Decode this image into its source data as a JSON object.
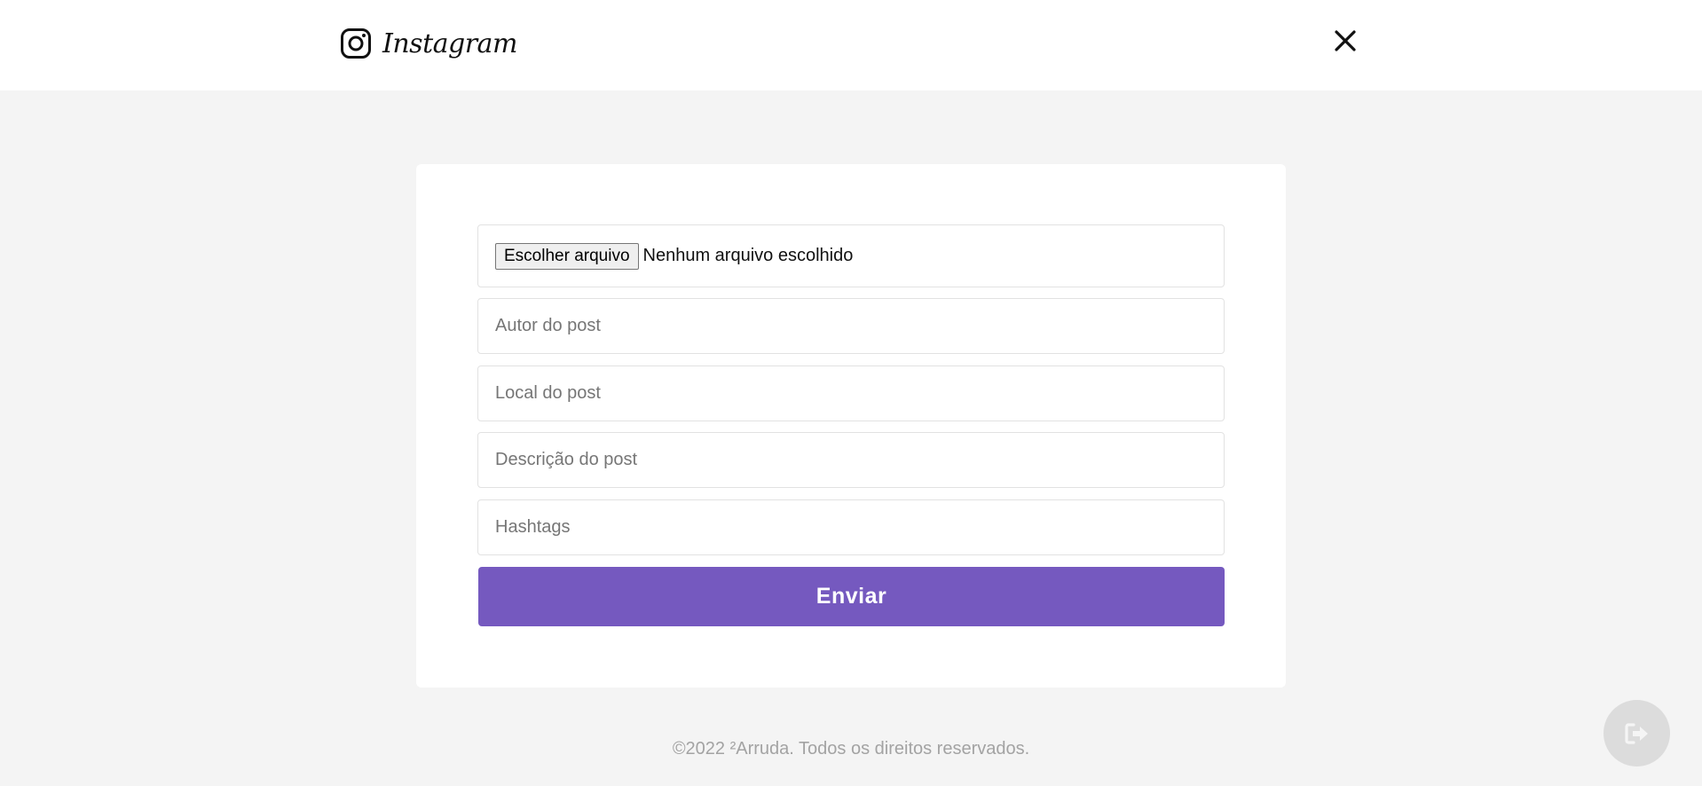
{
  "header": {
    "logo_text": "Instagram",
    "logo_icon": "instagram-icon",
    "close_icon": "close-icon"
  },
  "form": {
    "file_button_label": "Escolher arquivo",
    "file_status": "Nenhum arquivo escolhido",
    "author_placeholder": "Autor do post",
    "location_placeholder": "Local do post",
    "description_placeholder": "Descrição do post",
    "hashtags_placeholder": "Hashtags",
    "submit_label": "Enviar"
  },
  "footer": {
    "copyright": "©2022 ²Arruda. Todos os direitos reservados."
  },
  "floating": {
    "logout_icon": "sign-out-icon"
  },
  "colors": {
    "accent": "#7559bf",
    "background": "#f4f4f4",
    "card": "#ffffff",
    "footer_text": "#a3a3a3"
  }
}
